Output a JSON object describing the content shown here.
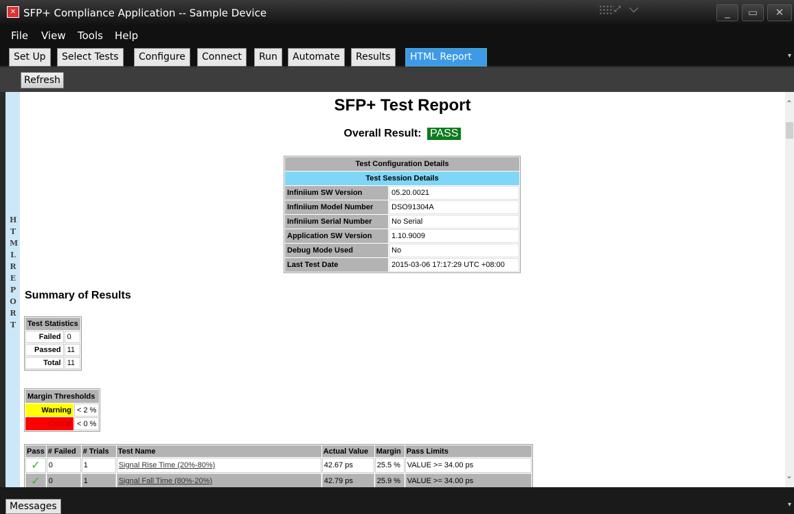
{
  "window": {
    "title": "SFP+ Compliance Application -- Sample Device",
    "icon": "app-logo-icon",
    "controls": [
      "minimize-icon",
      "maximize-icon",
      "close-icon"
    ]
  },
  "menu": [
    "File",
    "View",
    "Tools",
    "Help"
  ],
  "tabs": [
    {
      "label": "Set Up",
      "active": false
    },
    {
      "label": "Select Tests",
      "active": false
    },
    {
      "label": "Configure",
      "active": false
    },
    {
      "label": "Connect",
      "active": false
    },
    {
      "label": "Run",
      "active": false
    },
    {
      "label": "Automate",
      "active": false
    },
    {
      "label": "Results",
      "active": false
    },
    {
      "label": "HTML Report",
      "active": true
    }
  ],
  "toolbar": {
    "refresh_label": "Refresh"
  },
  "side_label": "HTML REPORT",
  "report": {
    "title": "SFP+ Test Report",
    "overall_label": "Overall Result:",
    "overall_value": "PASS",
    "config": {
      "header": "Test Configuration Details",
      "subheader": "Test Session Details",
      "rows": [
        {
          "label": "Infiniium SW Version",
          "value": "05.20.0021"
        },
        {
          "label": "Infiniium Model Number",
          "value": "DSO91304A"
        },
        {
          "label": "Infiniium Serial Number",
          "value": "No Serial"
        },
        {
          "label": "Application SW Version",
          "value": "1.10.9009"
        },
        {
          "label": "Debug Mode Used",
          "value": "No"
        },
        {
          "label": "Last Test Date",
          "value": "2015-03-06 17:17:29 UTC +08:00"
        }
      ]
    },
    "summary_heading": "Summary of Results",
    "stats": {
      "header": "Test Statistics",
      "rows": [
        {
          "label": "Failed",
          "value": "0"
        },
        {
          "label": "Passed",
          "value": "11"
        },
        {
          "label": "Total",
          "value": "11"
        }
      ]
    },
    "margins": {
      "header": "Margin Thresholds",
      "warning_label": "Warning",
      "warning_value": "< 2 %",
      "critical_label": "Critical",
      "critical_value": "< 0 %"
    },
    "results": {
      "columns": [
        "Pass",
        "# Failed",
        "# Trials",
        "Test Name",
        "Actual Value",
        "Margin",
        "Pass Limits"
      ],
      "rows": [
        {
          "failed": "0",
          "trials": "1",
          "name": "Signal Rise Time (20%-80%)",
          "actual": "42.67 ps",
          "margin": "25.5 %",
          "limits": "VALUE >= 34.00 ps"
        },
        {
          "failed": "0",
          "trials": "1",
          "name": "Signal Fall Time (80%-20%)",
          "actual": "42.79 ps",
          "margin": "25.9 %",
          "limits": "VALUE >= 34.00 ps"
        }
      ]
    }
  },
  "bottom": {
    "messages_label": "Messages"
  },
  "colors": {
    "pass": "#0d7c1e",
    "active_tab": "#3c9ae6",
    "session_header": "#7fd6f7",
    "warning": "#ffff00",
    "critical": "#ff0000"
  }
}
